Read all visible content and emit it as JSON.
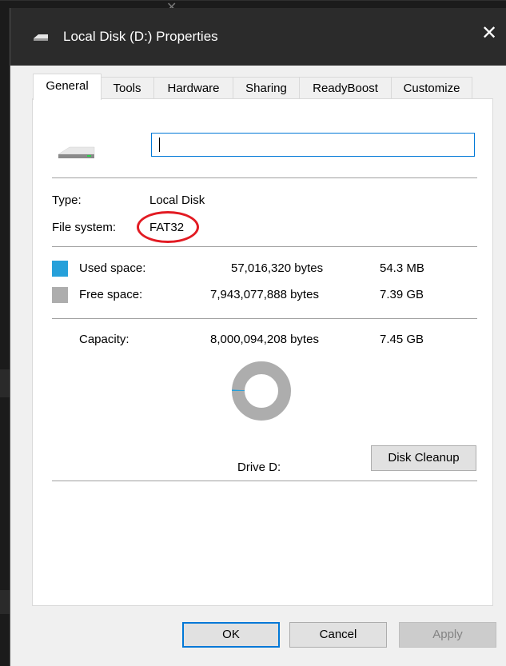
{
  "window": {
    "title": "Local Disk (D:) Properties",
    "close_glyph": "✕"
  },
  "tabs": [
    {
      "label": "General",
      "active": true
    },
    {
      "label": "Tools"
    },
    {
      "label": "Hardware"
    },
    {
      "label": "Sharing"
    },
    {
      "label": "ReadyBoost"
    },
    {
      "label": "Customize"
    }
  ],
  "general": {
    "volume_label_value": "",
    "type_label": "Type:",
    "type_value": "Local Disk",
    "fs_label": "File system:",
    "fs_value": "FAT32",
    "used_label": "Used space:",
    "used_bytes": "57,016,320 bytes",
    "used_short": "54.3 MB",
    "free_label": "Free space:",
    "free_bytes": "7,943,077,888 bytes",
    "free_short": "7.39 GB",
    "capacity_label": "Capacity:",
    "capacity_bytes": "8,000,094,208 bytes",
    "capacity_short": "7.45 GB",
    "drive_label": "Drive D:",
    "disk_cleanup_label": "Disk Cleanup",
    "used_fraction": 0.0071
  },
  "colors": {
    "used": "#26a0da",
    "free": "#adadad",
    "highlight": "#e21b23"
  },
  "footer": {
    "ok_label": "OK",
    "cancel_label": "Cancel",
    "apply_label": "Apply"
  },
  "icons": {
    "title_icon": "drive-icon",
    "drive_icon": "drive-icon",
    "close": "close-icon"
  }
}
